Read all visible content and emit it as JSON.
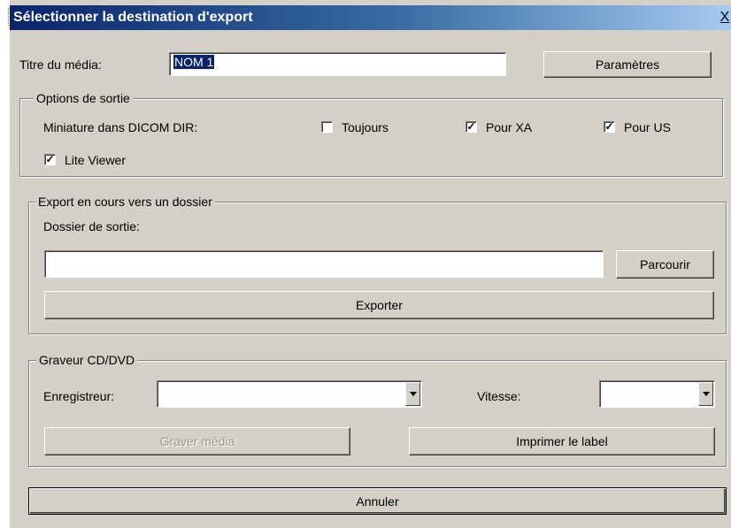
{
  "window": {
    "title": "Sélectionner la destination d'export",
    "close_label": "X"
  },
  "media": {
    "label": "Titre du média:",
    "value": "NOM 1",
    "settings_button": "Paramètres"
  },
  "output_options": {
    "legend": "Options de sortie",
    "thumbnail_label": "Miniature dans  DICOM DIR:",
    "checkboxes": [
      {
        "label": "Toujours",
        "checked": false
      },
      {
        "label": "Pour XA",
        "checked": true
      },
      {
        "label": "Pour US",
        "checked": true
      },
      {
        "label": "Lite Viewer",
        "checked": true
      }
    ]
  },
  "folder_export": {
    "legend": "Export en cours vers un dossier",
    "folder_label": "Dossier de sortie:",
    "folder_value": "",
    "browse_button": "Parcourir",
    "export_button": "Exporter"
  },
  "burner": {
    "legend": "Graveur CD/DVD",
    "recorder_label": "Enregistreur:",
    "recorder_value": "",
    "speed_label": "Vitesse:",
    "speed_value": "",
    "burn_button": "Graver média",
    "print_label_button": "Imprimer le label"
  },
  "cancel_button": "Annuler"
}
